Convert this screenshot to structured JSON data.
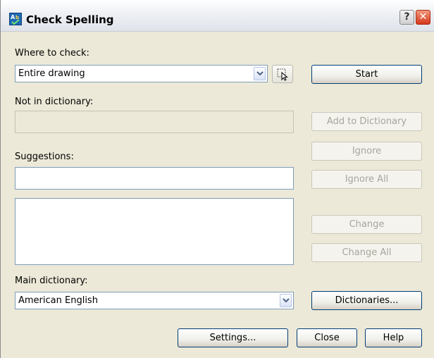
{
  "window": {
    "title": "Check Spelling"
  },
  "where_to_check": {
    "label": "Where to check:",
    "value": "Entire drawing"
  },
  "not_in_dictionary": {
    "label": "Not in dictionary:",
    "value": ""
  },
  "suggestions": {
    "label": "Suggestions:",
    "value": "",
    "list_items": []
  },
  "main_dictionary": {
    "label": "Main dictionary:",
    "value": "American English"
  },
  "buttons": {
    "start": "Start",
    "add_to_dictionary": "Add to Dictionary",
    "ignore": "Ignore",
    "ignore_all": "Ignore All",
    "change": "Change",
    "change_all": "Change All",
    "dictionaries": "Dictionaries...",
    "settings": "Settings...",
    "close": "Close",
    "help": "Help"
  },
  "titlebar_buttons": {
    "help_glyph": "?",
    "close_glyph": "✕"
  },
  "icons": {
    "app": "spell-check-icon",
    "select_objects": "select-objects-icon",
    "dropdown": "chevron-down-icon"
  },
  "colors": {
    "dialog_bg": "#ece9d8",
    "field_border": "#7f9db9",
    "button_border": "#003c74"
  }
}
